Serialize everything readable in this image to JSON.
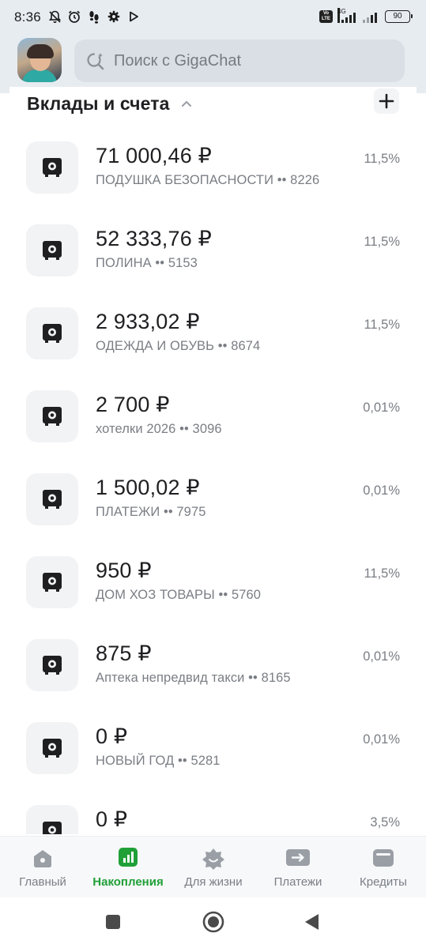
{
  "status_bar": {
    "time": "8:36",
    "network": "4G",
    "volte": "Vo LTE",
    "battery": "90"
  },
  "search": {
    "placeholder": "Поиск с GigaChat"
  },
  "section": {
    "title": "Вклады и счета"
  },
  "accounts": [
    {
      "amount": "71 000,46 ₽",
      "name": "ПОДУШКА БЕЗОПАСНОСТИ •• 8226",
      "rate": "11,5%"
    },
    {
      "amount": "52 333,76 ₽",
      "name": "ПОЛИНА •• 5153",
      "rate": "11,5%"
    },
    {
      "amount": "2 933,02 ₽",
      "name": "ОДЕЖДА И ОБУВЬ •• 8674",
      "rate": "11,5%"
    },
    {
      "amount": "2 700 ₽",
      "name": "хотелки 2026 •• 3096",
      "rate": "0,01%"
    },
    {
      "amount": "1 500,02 ₽",
      "name": "ПЛАТЕЖИ •• 7975",
      "rate": "0,01%"
    },
    {
      "amount": "950 ₽",
      "name": "ДОМ ХОЗ ТОВАРЫ •• 5760",
      "rate": "11,5%"
    },
    {
      "amount": "875 ₽",
      "name": "Аптека непредвид такси •• 8165",
      "rate": "0,01%"
    },
    {
      "amount": "0 ₽",
      "name": "НОВЫЙ ГОД •• 5281",
      "rate": "0,01%"
    },
    {
      "amount": "0 ₽",
      "name": "",
      "rate": "3,5%"
    }
  ],
  "bottom_nav": {
    "items": [
      {
        "label": "Главный",
        "icon": "home-icon"
      },
      {
        "label": "Накопления",
        "icon": "savings-chart-icon",
        "active": true
      },
      {
        "label": "Для жизни",
        "icon": "lifestyle-icon"
      },
      {
        "label": "Платежи",
        "icon": "transfer-icon"
      },
      {
        "label": "Кредиты",
        "icon": "wallet-icon"
      }
    ]
  },
  "colors": {
    "accent_green": "#21a038",
    "header_background": "#e7ecf1",
    "text_primary": "#1f1f22",
    "text_secondary": "#7a7e84"
  }
}
